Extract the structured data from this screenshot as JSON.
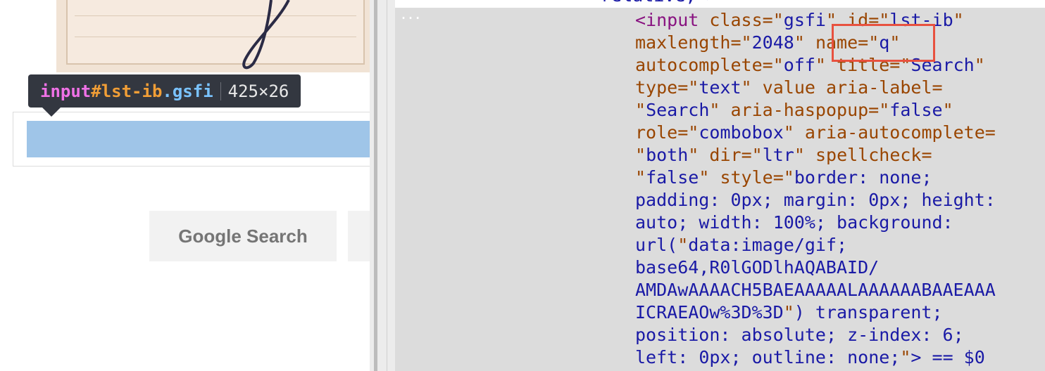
{
  "tooltip": {
    "tag": "input",
    "id": "#lst-ib",
    "cls": ".gsfi",
    "size": "425×26"
  },
  "left": {
    "button_label": "Google Search"
  },
  "devtools": {
    "top_text": "relative;\">",
    "ellipsis": "...",
    "code_lines": [
      "<input class=\"gsfi\" id=\"lst-ib\"",
      "maxlength=\"2048\" name=\"q\"",
      "autocomplete=\"off\" title=\"Search\"",
      "type=\"text\" value aria-label=",
      "\"Search\" aria-haspopup=\"false\"",
      "role=\"combobox\" aria-autocomplete=",
      "\"both\" dir=\"ltr\" spellcheck=",
      "\"false\" style=\"border: none;",
      "padding: 0px; margin: 0px; height:",
      "auto; width: 100%; background:",
      "url(\"data:image/gif;",
      "base64,R0lGODlhAQABAID/",
      "AMDAwAAAACH5BAEAAAAALAAAAAABAAEAAA",
      "ICRAEAOw%3D%3D\") transparent;",
      "position: absolute; z-index: 6;",
      "left: 0px; outline: none;\"> == $0"
    ]
  },
  "colors": {
    "highlight_box": "#e8513f",
    "tooltip_bg": "#333740",
    "selection": "#9fc5e8"
  }
}
